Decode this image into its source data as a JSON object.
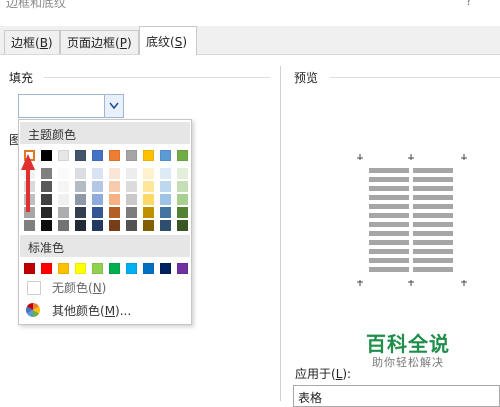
{
  "window": {
    "title": "边框和底纹",
    "help": "?"
  },
  "tabs": [
    {
      "label": "边框(",
      "key": "B",
      "tail": ")"
    },
    {
      "label": "页面边框(",
      "key": "P",
      "tail": ")"
    },
    {
      "label": "底纹(",
      "key": "S",
      "tail": ")"
    }
  ],
  "fill": {
    "label": "填充",
    "value": ""
  },
  "pattern": {
    "label_fragment": "图"
  },
  "palette": {
    "theme_header": "主题颜色",
    "standard_header": "标准色",
    "theme_colors": [
      "#ffffff",
      "#000000",
      "#e7e6e6",
      "#44546a",
      "#4472c4",
      "#ed7d31",
      "#a5a5a5",
      "#ffc000",
      "#5b9bd5",
      "#70ad47"
    ],
    "standard_colors": [
      "#c00000",
      "#ff0000",
      "#ffc000",
      "#ffff00",
      "#92d050",
      "#00b050",
      "#00b0f0",
      "#0070c0",
      "#002060",
      "#7030a0"
    ],
    "no_color": {
      "label": "无颜色(",
      "key": "N",
      "tail": ")"
    },
    "more_colors": {
      "label": "其他颜色(",
      "key": "M",
      "tail": ")..."
    }
  },
  "preview": {
    "label": "预览"
  },
  "apply_to": {
    "label": "应用于(",
    "key": "L",
    "tail": "):",
    "value": "表格"
  },
  "watermark": {
    "title": "百科全说",
    "subtitle": "助你轻松解决"
  }
}
